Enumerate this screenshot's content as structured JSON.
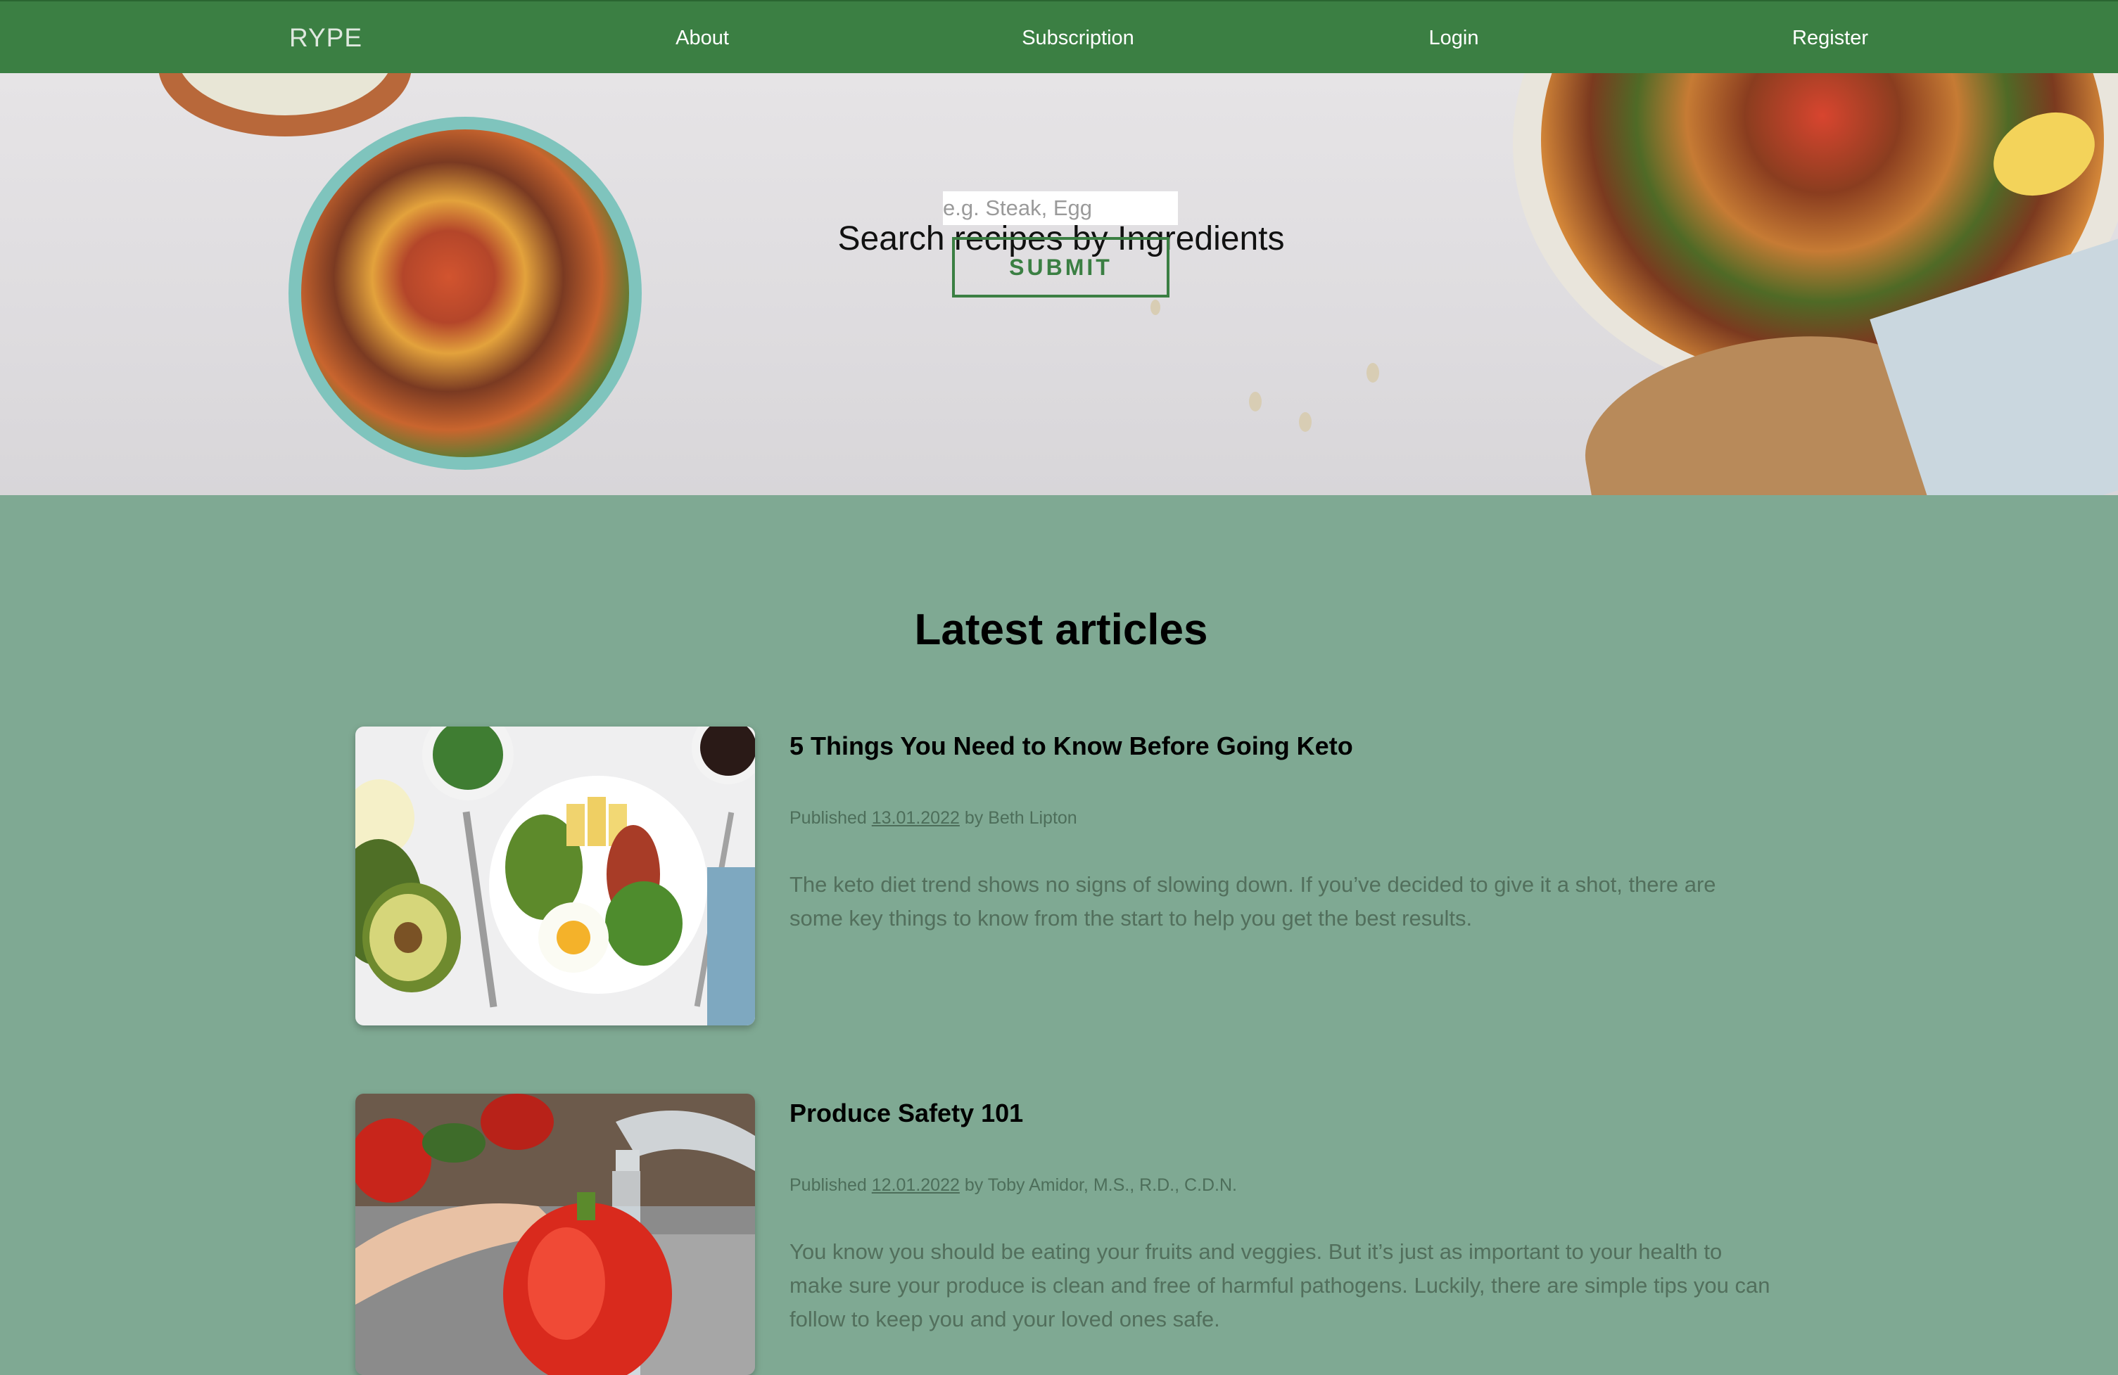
{
  "nav": {
    "logo": "RYPE",
    "items": [
      "About",
      "Subscription",
      "Login",
      "Register"
    ]
  },
  "hero": {
    "title": "Search recipes by Ingredients",
    "search_placeholder": "e.g. Steak, Egg",
    "submit_label": "SUBMIT"
  },
  "articles_section": {
    "title": "Latest articles",
    "articles": [
      {
        "title": "5 Things You Need to Know Before Going Keto",
        "published_prefix": "Published",
        "date": "13.01.2022",
        "author_prefix": "by",
        "author": "Beth Lipton",
        "excerpt": "The keto diet trend shows no signs of slowing down. If you’ve decided to give it a shot, there are some key things to know from the start to help you get the best results."
      },
      {
        "title": "Produce Safety 101",
        "published_prefix": "Published",
        "date": "12.01.2022",
        "author_prefix": "by",
        "author": "Toby Amidor, M.S., R.D., C.D.N.",
        "excerpt": "You know you should be eating your fruits and veggies. But it’s just as important to your health to make sure your produce is clean and free of harmful pathogens. Luckily, there are simple tips you can follow to keep you and your loved ones safe."
      }
    ]
  },
  "colors": {
    "nav_green": "#3b7f43",
    "page_background": "#7fa993",
    "button_green": "#3b7f43"
  }
}
